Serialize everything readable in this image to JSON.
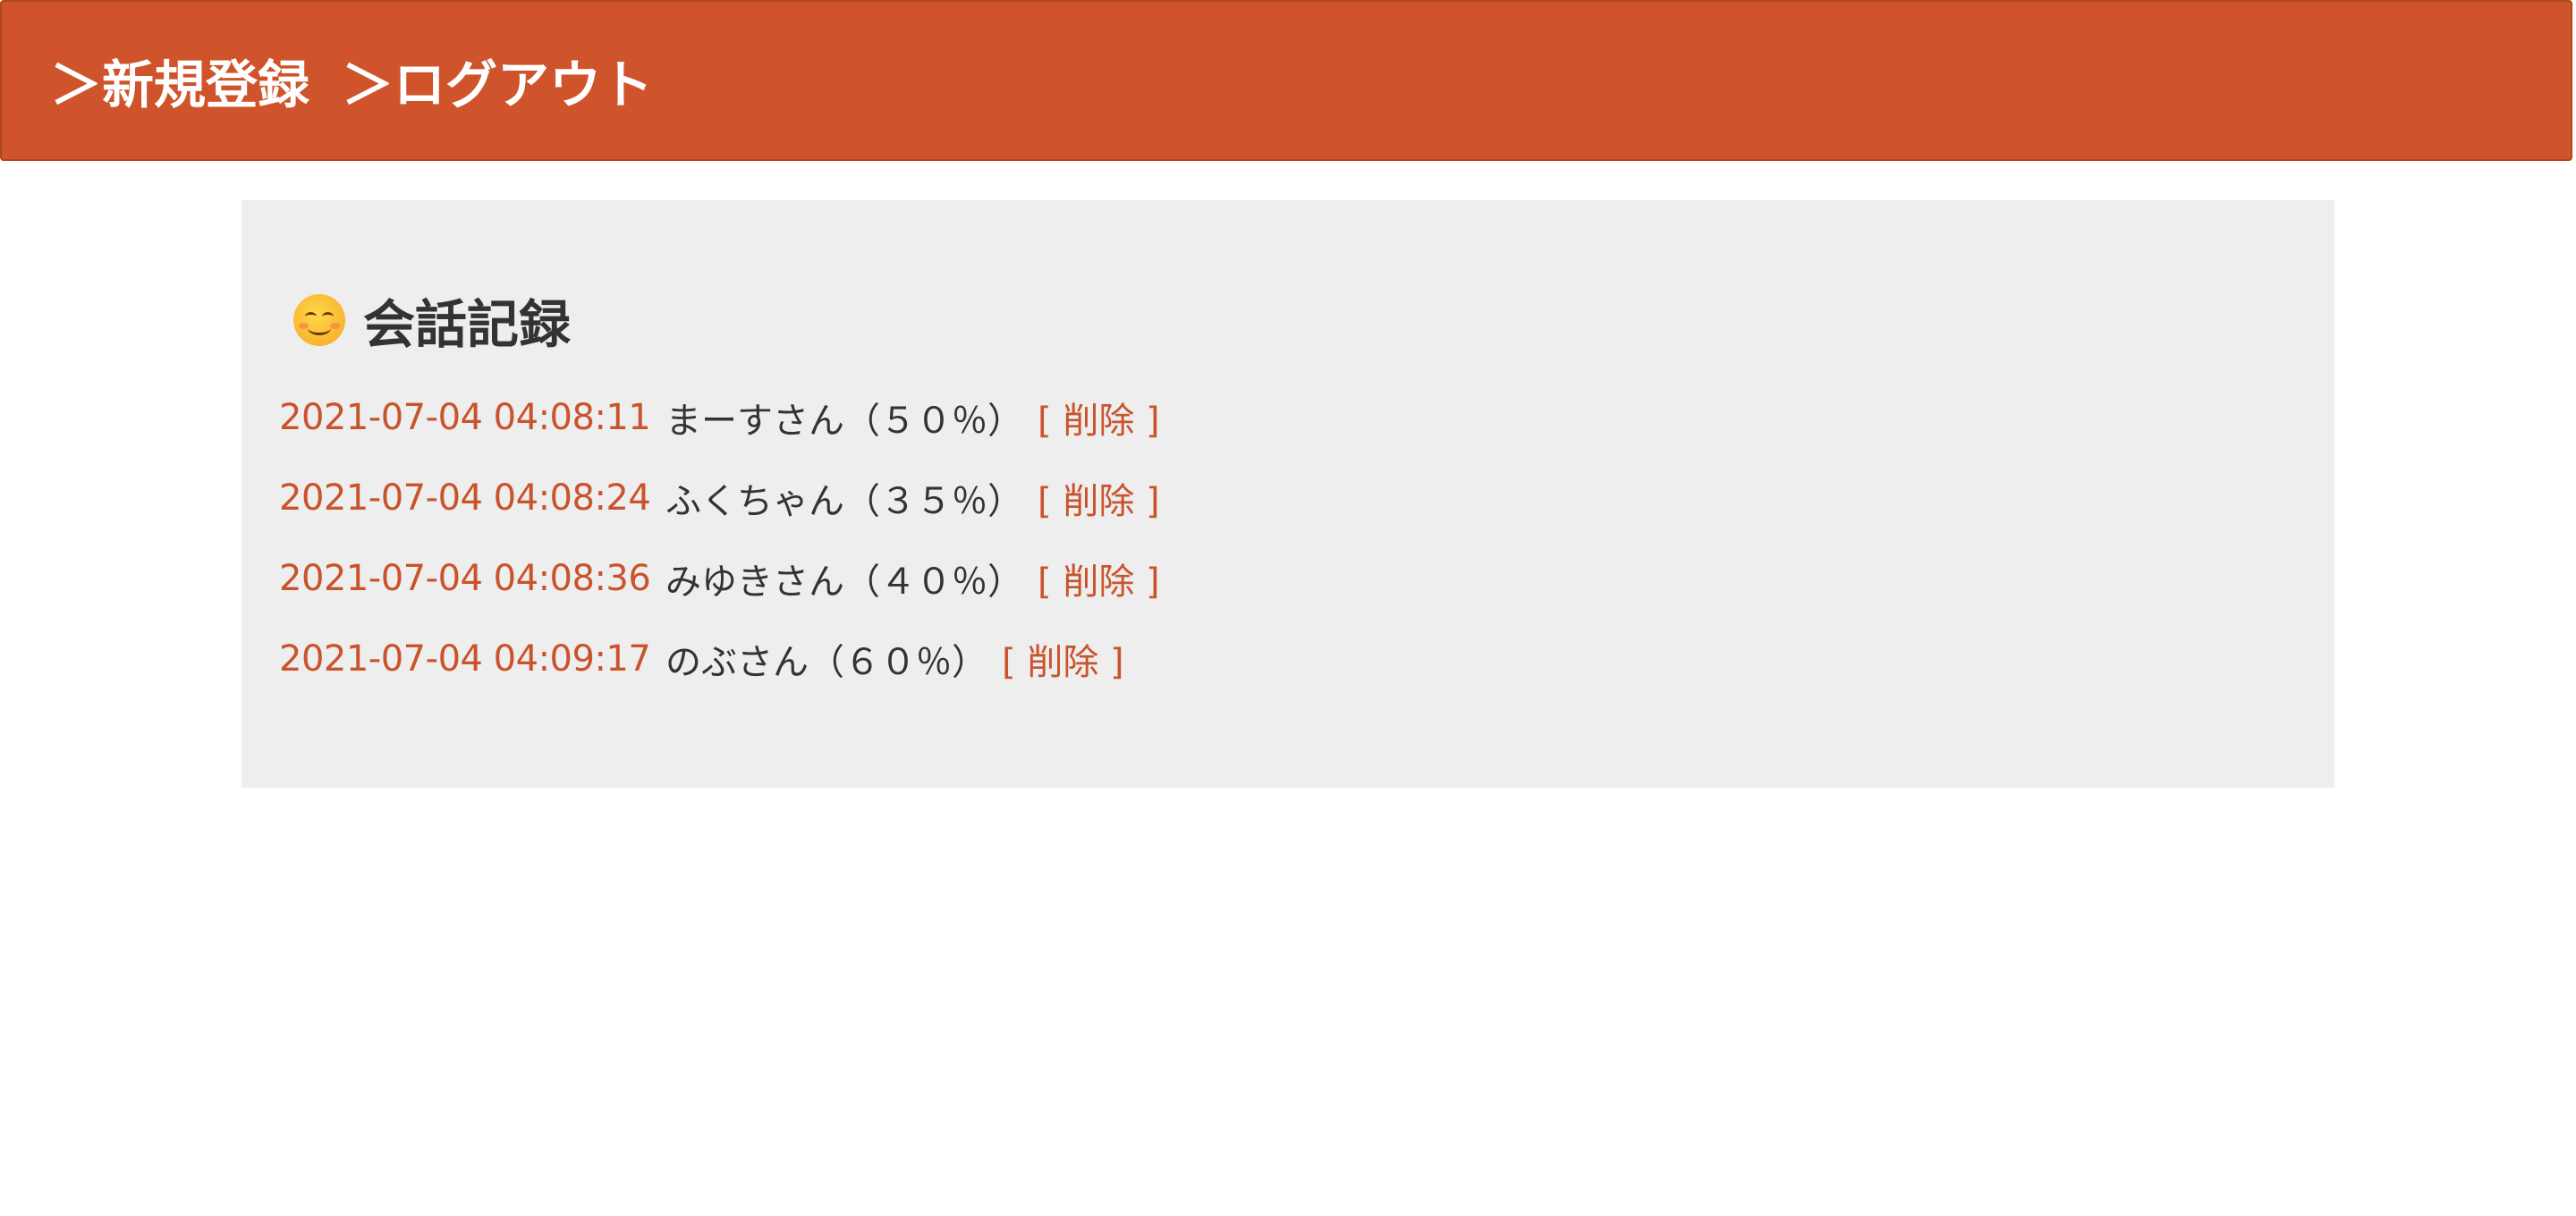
{
  "header": {
    "register_label": "＞新規登録",
    "logout_label": "＞ログアウト",
    "background_color": "#cf542b"
  },
  "panel": {
    "title_icon": "smiling-face-icon",
    "title": "会話記録",
    "background_color": "#eeeeee",
    "records": [
      {
        "timestamp": "2021-07-04 04:08:11",
        "text": "まーすさん（５０％）",
        "delete_label": "[ 削除 ]"
      },
      {
        "timestamp": "2021-07-04 04:08:24",
        "text": "ふくちゃん（３５％）",
        "delete_label": "[ 削除 ]"
      },
      {
        "timestamp": "2021-07-04 04:08:36",
        "text": "みゆきさん（４０％）",
        "delete_label": "[ 削除 ]"
      },
      {
        "timestamp": "2021-07-04 04:09:17",
        "text": "のぶさん（６０％）",
        "delete_label": "[ 削除 ]"
      }
    ]
  },
  "colors": {
    "accent": "#c9532b",
    "text": "#333333"
  }
}
